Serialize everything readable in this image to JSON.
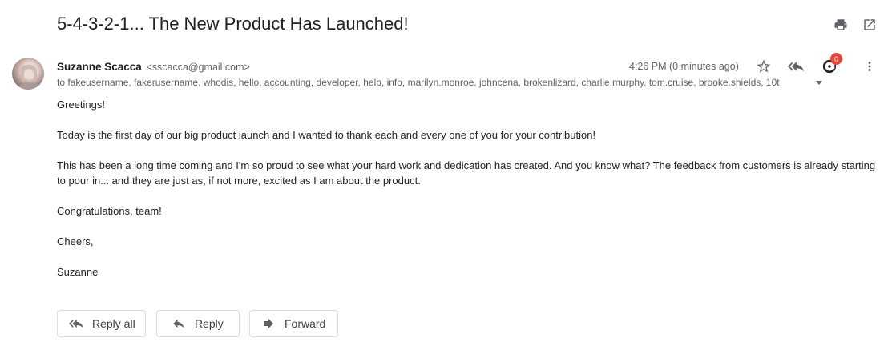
{
  "email": {
    "subject": "5-4-3-2-1... The New Product Has Launched!",
    "sender_name": "Suzanne Scacca",
    "sender_email": "<sscacca@gmail.com>",
    "time": "4:26 PM (0 minutes ago)",
    "recipients": "to fakeusername, fakerusername, whodis, hello, accounting, developer, help, info, marilyn.monroe, johncena, brokenlizard, charlie.murphy, tom.cruise, brooke.shields, 10t",
    "badge_count": "0",
    "body": [
      "Greetings!",
      "Today is the first day of our big product launch and I wanted to thank each and every one of you for your contribution!",
      "This has been a long time coming and I'm so proud to see what your hard work and dedication has created. And you know what? The feedback from customers is already starting to pour in... and they are just as, if not more, excited as I am about the product.",
      "Congratulations, team!",
      "Cheers,",
      "Suzanne"
    ]
  },
  "actions": {
    "reply_all": "Reply all",
    "reply": "Reply",
    "forward": "Forward"
  },
  "icons": {
    "print": "print-icon",
    "open_new_window": "open-in-new-window-icon",
    "star": "star-icon",
    "reply_all": "reply-all-icon",
    "extension": "extension-icon",
    "more": "more-vert-icon",
    "forward": "forward-icon"
  },
  "colors": {
    "badge": "#ea4335",
    "icon": "#5f6368"
  }
}
